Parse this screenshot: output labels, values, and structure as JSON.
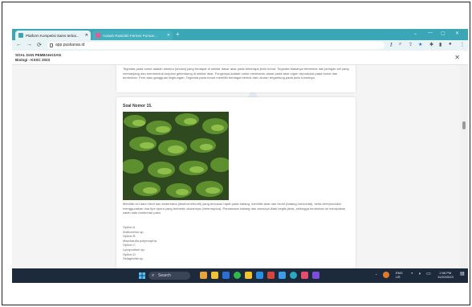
{
  "browser": {
    "tabs": [
      {
        "label": "Platform Kompetisi Sains terbai...",
        "active": true
      },
      {
        "label": "Aulaah Rasiidah Farmer Pursue...",
        "active": false
      }
    ],
    "url": "app.puskanas.id"
  },
  "app_header": {
    "title": "SOAL DAN PEMBAHASAN",
    "subtitle": "Biologi - KSSC 2023"
  },
  "prev_card": {
    "text": "Tegmata pada tumut adalah struktur [shown] yang terdapat di sekitar dasar akar pada beberapa jenis tumut. Tegmata biasanya terbentuk dari jaringan sel yang memanjang dan membentuk tonjolan gelembung di sekitar akar. Fungsinya adalah untuk membantu dasar pada akar organ reproduksi pada tumut dan tumbuhan. Fern atau gangguan lingkungan. Tegmata pada tumut memiliki berbagai bentuk dan ukuran tergantung pada jenis tumutnya."
  },
  "question": {
    "title": "Soal Nomor 15.",
    "text": "Memiliki ciri daun kecil dan sederhana (disebut mikrofil) yang tersusun rapat pada batang, memiliki akar dan rizoid (batang horizontal), serta bereproduksi menggunakan dua tipe spora yang berbeda ukurannya (heterospora). Persamaan batang dan daunnya tidak begitu jelas, sehingga tumbuhan ini merupakan salah satu tumbuhan paku.",
    "options": [
      {
        "label": "Option A",
        "answer": "Anthoceros sp."
      },
      {
        "label": "Option B",
        "answer": "Marchantia polymorpha"
      },
      {
        "label": "Option C",
        "answer": "Lycopodium sp."
      },
      {
        "label": "Option D",
        "answer": "Selaginella sp."
      }
    ]
  },
  "taskbar": {
    "search_label": "Search",
    "lang": "ENG",
    "region": "US",
    "time": "2:06 PM",
    "date": "11/20/2023"
  },
  "colors": {
    "tabbar": "#3aa6b6",
    "taskbar": "#1c2a3c",
    "watermark": "#cfe0ee"
  },
  "icons": [
    "back-icon",
    "forward-icon",
    "reload-icon",
    "lock-icon",
    "star-icon",
    "close-icon",
    "windows-icon",
    "search-icon"
  ]
}
